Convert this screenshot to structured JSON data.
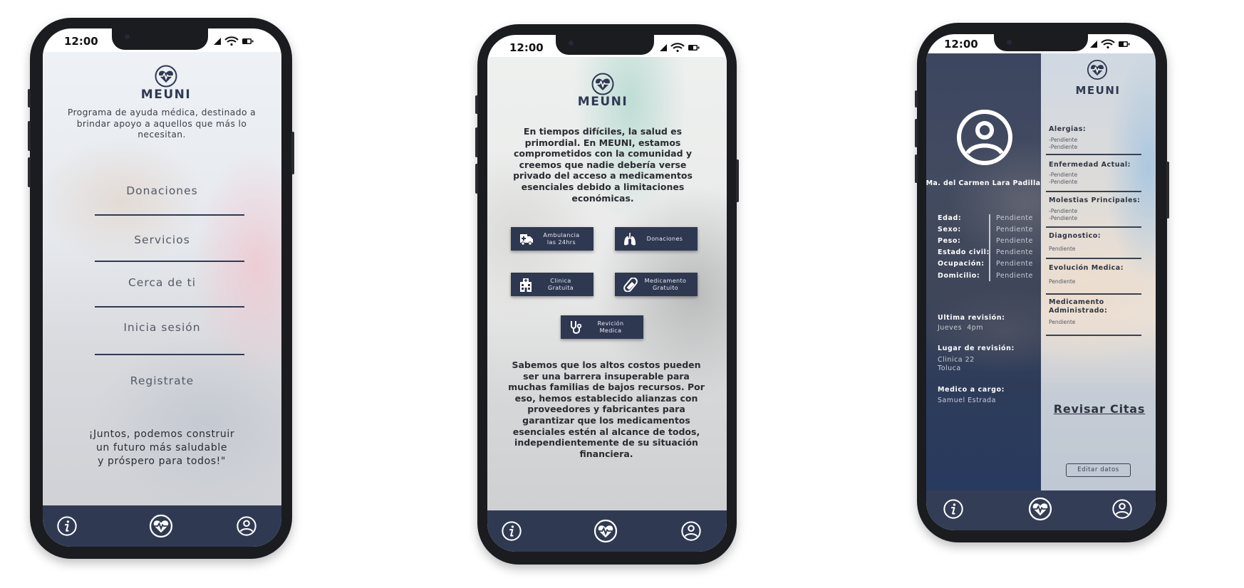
{
  "brand": {
    "name": "MEUNI",
    "status_time": "12:00",
    "nav_color": "#2f3a52"
  },
  "nav": {
    "items": [
      "info",
      "health",
      "profile"
    ]
  },
  "screen1": {
    "tagline": [
      "Programa de ayuda médica, destinado a",
      "brindar apoyo a aquellos que más lo",
      "necesitan."
    ],
    "menu": [
      "Donaciones",
      "Servicios",
      "Cerca de ti",
      "Inicia sesión",
      "Registrate"
    ],
    "quote": [
      "¡Juntos, podemos construir",
      "un futuro más saludable",
      "y próspero para todos!\""
    ]
  },
  "screen2": {
    "intro": [
      "En tiempos difíciles, la salud es",
      "primordial. En MEUNI, estamos",
      "comprometidos con la comunidad y",
      "creemos que nadie debería verse",
      "privado del acceso a medicamentos",
      "esenciales debido a limitaciones",
      "económicas."
    ],
    "services": [
      {
        "line1": "Ambulancia",
        "line2": "las 24hrs",
        "icon": "ambulance-icon"
      },
      {
        "line1": "Donaciones",
        "line2": "",
        "icon": "lungs-icon"
      },
      {
        "line1": "Clinica",
        "line2": "Gratuita",
        "icon": "hospital-icon"
      },
      {
        "line1": "Medicamento",
        "line2": "Gratuito",
        "icon": "pill-icon"
      },
      {
        "line1": "Revición",
        "line2": "Medica",
        "icon": "stethoscope-icon"
      }
    ],
    "outro": [
      "Sabemos que los altos costos  pueden",
      "ser una barrera insuperable para",
      "muchas familias de bajos recursos. Por",
      "eso, hemos establecido alianzas con",
      "proveedores y fabricantes para",
      "garantizar que los medicamentos",
      "esenciales estén al alcance de todos,",
      "independientemente de su situación",
      "financiera."
    ]
  },
  "screen3": {
    "patient_name": "Ma. del Carmen Lara Padilla",
    "fields": [
      {
        "label": "Edad:",
        "value": "Pendiente"
      },
      {
        "label": "Sexo:",
        "value": "Pendiente"
      },
      {
        "label": "Peso:",
        "value": "Pendiente"
      },
      {
        "label": "Estado civil:",
        "value": "Pendiente"
      },
      {
        "label": "Ocupación:",
        "value": "Pendiente"
      },
      {
        "label": "Domicilio:",
        "value": "Pendiente"
      }
    ],
    "last_review": {
      "label": "Ultima revisión:",
      "value": "Jueves  4pm"
    },
    "review_place": {
      "label": "Lugar de revisión:",
      "line1": "Clinica 22",
      "line2": "Toluca"
    },
    "doctor": {
      "label": "Medico a cargo:",
      "value": "Samuel Estrada"
    },
    "sections": [
      {
        "title": "Alergias:",
        "items": [
          "-Pendiente",
          "-Pendiente"
        ]
      },
      {
        "title": "Enfermedad Actual:",
        "items": [
          "-Pendiente",
          "-Pendiente"
        ]
      },
      {
        "title": "Molestias Principales:",
        "items": [
          "-Pendiente",
          "-Pendiente"
        ]
      },
      {
        "title": "Diagnostico:",
        "items": [
          "Pendiente"
        ]
      },
      {
        "title": "Evolución Medica:",
        "items": [
          "Pendiente"
        ]
      },
      {
        "title_line1": "Medicamento",
        "title_line2": "Administrado:",
        "items": [
          "Pendiente"
        ]
      }
    ],
    "appointments_link": "Revisar Citas",
    "edit_button": "Editar datos"
  }
}
